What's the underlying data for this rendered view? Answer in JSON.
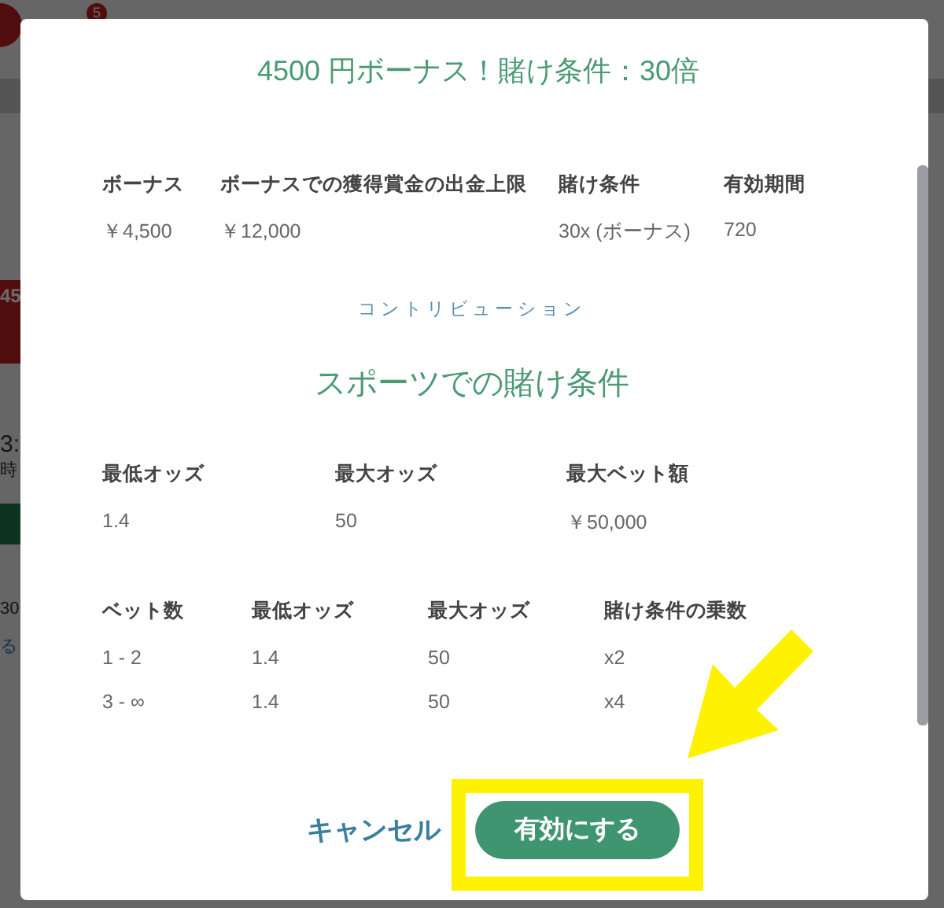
{
  "background": {
    "badge": "5",
    "fragments": [
      {
        "text": "45",
        "kind": "banner"
      },
      {
        "text": "3:",
        "kind": "large"
      },
      {
        "text": "時",
        "kind": "text"
      },
      {
        "text": "30",
        "kind": "text"
      },
      {
        "text": "る",
        "kind": "link"
      }
    ]
  },
  "dialog": {
    "title": "4500 円ボーナス！賭け条件：30倍",
    "bonus_table": {
      "columns": [
        "ボーナス",
        "ボーナスでの獲得賞金の出金上限",
        "賭け条件",
        "有効期間"
      ],
      "rows": [
        [
          "￥4,500",
          "￥12,000",
          "30x (ボーナス)",
          "720"
        ]
      ]
    },
    "contribution_label": "コントリビューション",
    "section_title": "スポーツでの賭け条件",
    "odds_table": {
      "columns": [
        "最低オッズ",
        "最大オッズ",
        "最大ベット額"
      ],
      "rows": [
        [
          "1.4",
          "50",
          "￥50,000"
        ]
      ]
    },
    "multiplier_table": {
      "columns": [
        "ベット数",
        "最低オッズ",
        "最大オッズ",
        "賭け条件の乗数"
      ],
      "rows": [
        [
          "1 - 2",
          "1.4",
          "50",
          "x2"
        ],
        [
          "3 - ∞",
          "1.4",
          "50",
          "x4"
        ]
      ]
    },
    "buttons": [
      {
        "label": "キャンセル",
        "kind": "link"
      },
      {
        "label": "有効にする",
        "kind": "primary"
      }
    ]
  }
}
